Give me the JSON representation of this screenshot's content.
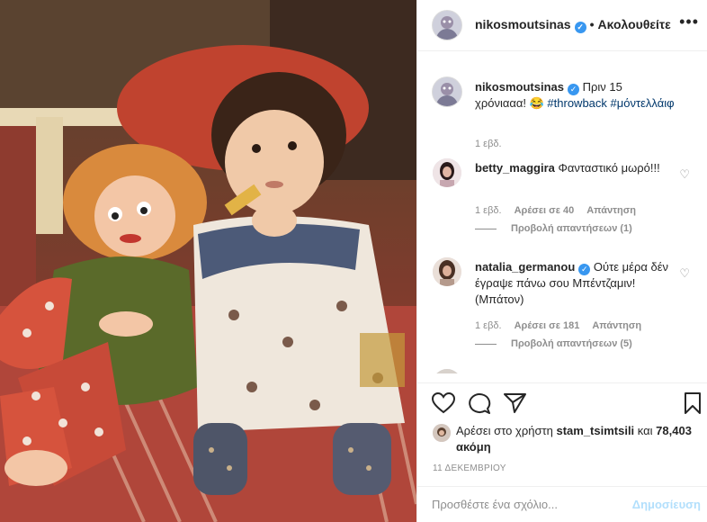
{
  "header": {
    "username": "nikosmoutsinas",
    "separator": "•",
    "follow_status": "Ακολουθείτε",
    "more": "•••"
  },
  "caption": {
    "username": "nikosmoutsinas",
    "text": "Πριν 15 χρόνιααα! 😂",
    "hashtag1": "#throwback",
    "hashtag2": "#μόντελλάιφ",
    "time": "1 εβδ."
  },
  "comments": [
    {
      "username": "betty_maggira",
      "text": "Φανταστικό μωρό!!!",
      "time": "1 εβδ.",
      "likes": "Αρέσει σε 40",
      "reply": "Απάντηση",
      "view_replies": "Προβολή απαντήσεων (1)"
    },
    {
      "username": "natalia_germanou",
      "text": "Ούτε μέρα δέν έγραψε πάνω σου Μπέντζαμιν! (Μπάτον)",
      "time": "1 εβδ.",
      "likes": "Αρέσει σε 181",
      "reply": "Απάντηση",
      "view_replies": "Προβολή απαντήσεων (5)"
    }
  ],
  "likes": {
    "prefix": "Αρέσει στο χρήστη",
    "user": "stam_tsimtsili",
    "connector": "και",
    "count": "78,403 ακόμη"
  },
  "date": "11 ΔΕΚΕΜΒΡΙΟΥ",
  "add_comment": {
    "placeholder": "Προσθέστε ένα σχόλιο...",
    "post_label": "Δημοσίευση"
  },
  "colors": {
    "verified": "#3897f0",
    "link": "#00376b",
    "post_disabled": "#b2dffc",
    "muted": "#8e8e8e"
  },
  "icons": [
    "heart-icon",
    "comment-icon",
    "share-icon",
    "bookmark-icon",
    "verified-icon",
    "more-icon"
  ]
}
